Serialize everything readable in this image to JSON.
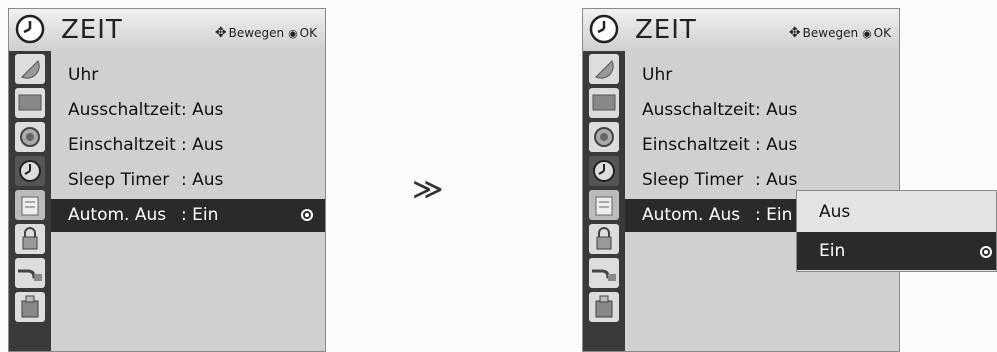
{
  "left_menu": {
    "title": "ZEIT",
    "nav_hint": {
      "move": "Bewegen",
      "ok": "OK"
    },
    "items": [
      {
        "label": "Uhr",
        "value": ""
      },
      {
        "label": "Ausschaltzeit",
        "value": ": Aus"
      },
      {
        "label": "Einschaltzeit",
        "value": ": Aus"
      },
      {
        "label": "Sleep Timer",
        "value": ": Aus"
      },
      {
        "label": "Autom. Aus",
        "value": ": Ein",
        "selected": true
      }
    ]
  },
  "transition_symbol": "≫",
  "right_menu": {
    "title": "ZEIT",
    "nav_hint": {
      "move": "Bewegen",
      "ok": "OK"
    },
    "items": [
      {
        "label": "Uhr",
        "value": ""
      },
      {
        "label": "Ausschaltzeit",
        "value": ": Aus"
      },
      {
        "label": "Einschaltzeit",
        "value": ": Aus"
      },
      {
        "label": "Sleep Timer",
        "value": ": Aus"
      },
      {
        "label": "Autom. Aus",
        "value": ": Ein",
        "selected": true
      }
    ],
    "popup": {
      "options": [
        {
          "label": "Aus",
          "selected": false
        },
        {
          "label": "Ein",
          "selected": true
        }
      ]
    }
  },
  "sidebar_icons": [
    "satellite-dish-icon",
    "tv-screen-icon",
    "speaker-icon",
    "clock-icon",
    "options-icon",
    "lock-icon",
    "input-cable-icon",
    "usb-icon"
  ],
  "colors": {
    "selected_row": "#2a2a2a",
    "menu_background": "#d0d0d0",
    "icon_bar": "#3a3a3a"
  }
}
